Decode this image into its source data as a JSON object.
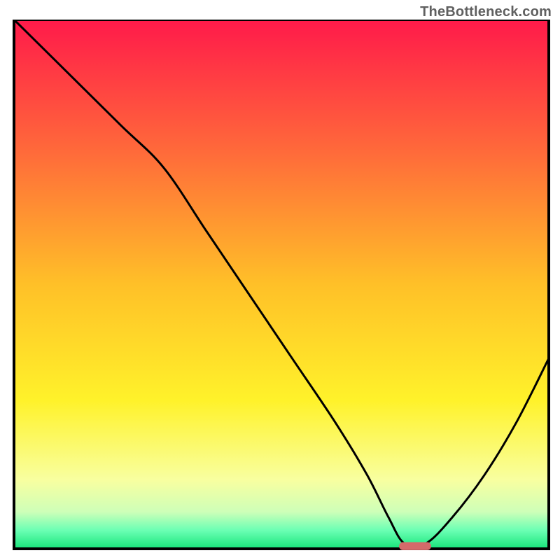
{
  "watermark": "TheBottleneck.com",
  "chart_data": {
    "type": "line",
    "title": "",
    "xlabel": "",
    "ylabel": "",
    "xlim": [
      0,
      100
    ],
    "ylim": [
      0,
      100
    ],
    "grid": false,
    "legend": false,
    "background_gradient": {
      "stops": [
        {
          "offset": 0.0,
          "color": "#ff1a4a"
        },
        {
          "offset": 0.25,
          "color": "#ff6a3a"
        },
        {
          "offset": 0.5,
          "color": "#ffc028"
        },
        {
          "offset": 0.72,
          "color": "#fff22a"
        },
        {
          "offset": 0.87,
          "color": "#f8ffa0"
        },
        {
          "offset": 0.93,
          "color": "#ceffb8"
        },
        {
          "offset": 0.965,
          "color": "#6bffb4"
        },
        {
          "offset": 1.0,
          "color": "#17e47a"
        }
      ]
    },
    "series": [
      {
        "name": "bottleneck-curve",
        "color": "#000000",
        "x": [
          0,
          10,
          20,
          28,
          36,
          44,
          52,
          60,
          66,
          70,
          73,
          77,
          82,
          88,
          94,
          100
        ],
        "y": [
          100,
          90,
          80,
          72,
          60,
          48,
          36,
          24,
          14,
          6,
          1,
          1,
          6,
          14,
          24,
          36
        ]
      }
    ],
    "marker": {
      "name": "optimal-range-marker",
      "color": "#d46a6a",
      "x_center": 75,
      "y": 0.5,
      "width": 6,
      "height": 1.5,
      "rx": 1.0
    }
  }
}
